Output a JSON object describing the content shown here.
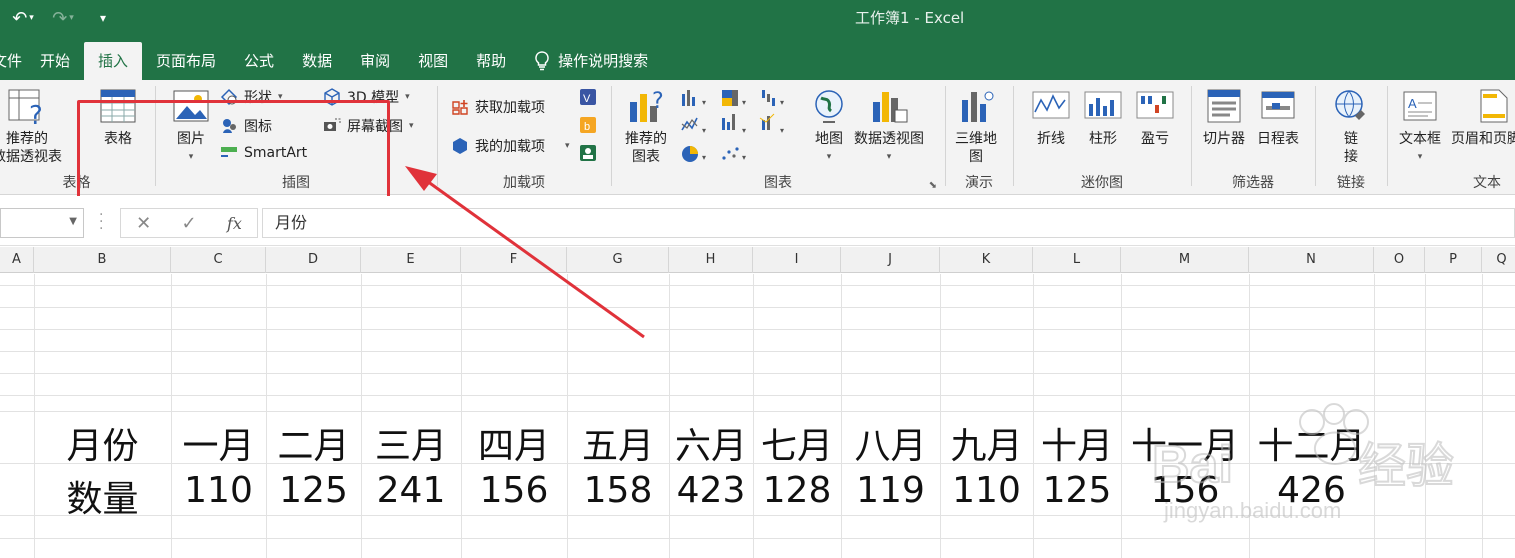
{
  "window": {
    "title": "工作簿1  -  Excel"
  },
  "ribbon_tabs": [
    "文件",
    "开始",
    "插入",
    "页面布局",
    "公式",
    "数据",
    "审阅",
    "视图",
    "帮助"
  ],
  "tell_me": "操作说明搜索",
  "groups": {
    "tables": {
      "label": "表格",
      "pivot": "推荐的\n数据透视表",
      "pivot_cut": "数据透视表",
      "table": "表格"
    },
    "illustrations": {
      "label": "插图",
      "pictures": "图片",
      "shapes": "形状",
      "icons": "图标",
      "smartart": "SmartArt",
      "model3d": "3D 模型",
      "screenshot": "屏幕截图"
    },
    "addins": {
      "label": "加载项",
      "get": "获取加载项",
      "my": "我的加载项"
    },
    "charts": {
      "label": "图表",
      "recommended": "推荐的\n图表",
      "maps": "地图",
      "pivotchart": "数据透视图"
    },
    "tours": {
      "label": "演示",
      "map3d": "三维地\n图"
    },
    "sparklines": {
      "label": "迷你图",
      "line": "折线",
      "column": "柱形",
      "winloss": "盈亏"
    },
    "filters": {
      "label": "筛选器",
      "slicer": "切片器",
      "timeline": "日程表"
    },
    "links": {
      "label": "链接",
      "link": "链\n接"
    },
    "text": {
      "label": "文本",
      "textbox": "文本框",
      "headerfooter": "页眉和页脚"
    }
  },
  "formula_bar": {
    "name_box": "",
    "content": "月份"
  },
  "columns": [
    "A",
    "B",
    "C",
    "D",
    "E",
    "F",
    "G",
    "H",
    "I",
    "J",
    "K",
    "L",
    "M",
    "N",
    "O",
    "P",
    "Q"
  ],
  "table": {
    "row1": [
      "月份",
      "一月",
      "二月",
      "三月",
      "四月",
      "五月",
      "六月",
      "七月",
      "八月",
      "九月",
      "十月",
      "十一月",
      "十二月"
    ],
    "row2": [
      "数量",
      "110",
      "125",
      "241",
      "156",
      "158",
      "423",
      "128",
      "119",
      "110",
      "125",
      "156",
      "426"
    ]
  },
  "colors": {
    "accent": "#217346",
    "annotation": "#e0323a"
  },
  "watermark": {
    "text": "Baidu经验",
    "url": "jingyan.baidu.com"
  }
}
